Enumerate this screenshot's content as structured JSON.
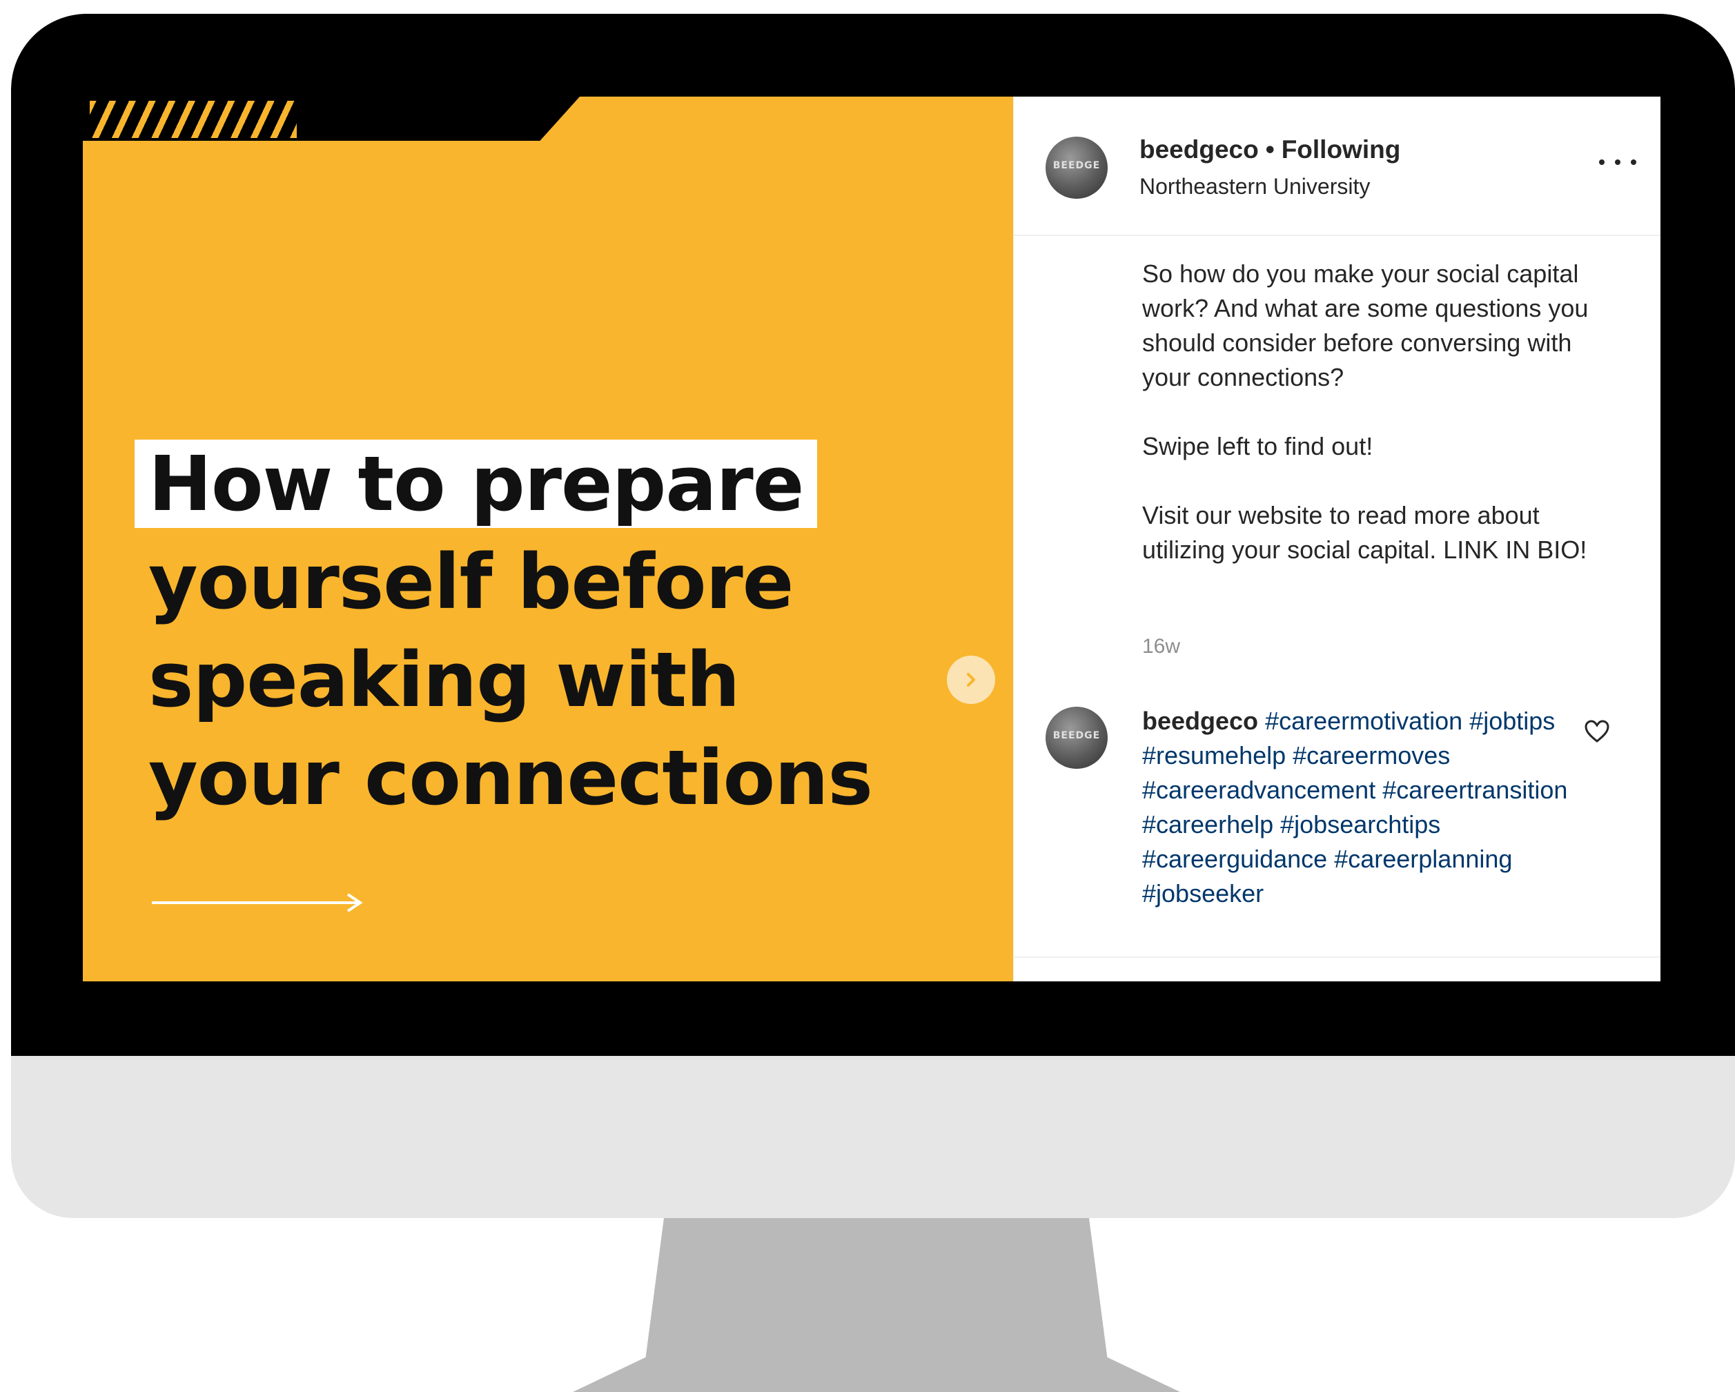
{
  "post": {
    "headline_lines": [
      "How to prepare",
      "yourself before",
      "speaking with",
      "your connections"
    ],
    "avatar_text": "BEEDGE"
  },
  "header": {
    "username": "beedgeco",
    "separator": "•",
    "follow_status": "Following",
    "location": "Northeastern University"
  },
  "caption": {
    "paragraphs": [
      "So how do you make your social capital work? And what are some questions you should consider before conversing with your connections?",
      "Swipe left to find out!",
      "Visit our website to read more about utilizing your social capital. LINK IN BIO!"
    ],
    "timestamp": "16w"
  },
  "comment": {
    "username": "beedgeco",
    "hashtags": [
      "#careermotivation",
      "#jobtips",
      "#resumehelp",
      "#careermoves",
      "#careeradvancement",
      "#careertransition",
      "#careerhelp",
      "#jobsearchtips",
      "#careerguidance",
      "#careerplanning",
      "#jobseeker"
    ]
  },
  "icons": {
    "next": "chevron-right-icon",
    "more": "more-options-icon",
    "like": "heart-icon",
    "arrow": "arrow-right-icon"
  },
  "colors": {
    "post_background": "#f9b52d",
    "headline_text": "#111111",
    "hashtag_link": "#00376b",
    "timestamp": "#8e8e8e"
  }
}
